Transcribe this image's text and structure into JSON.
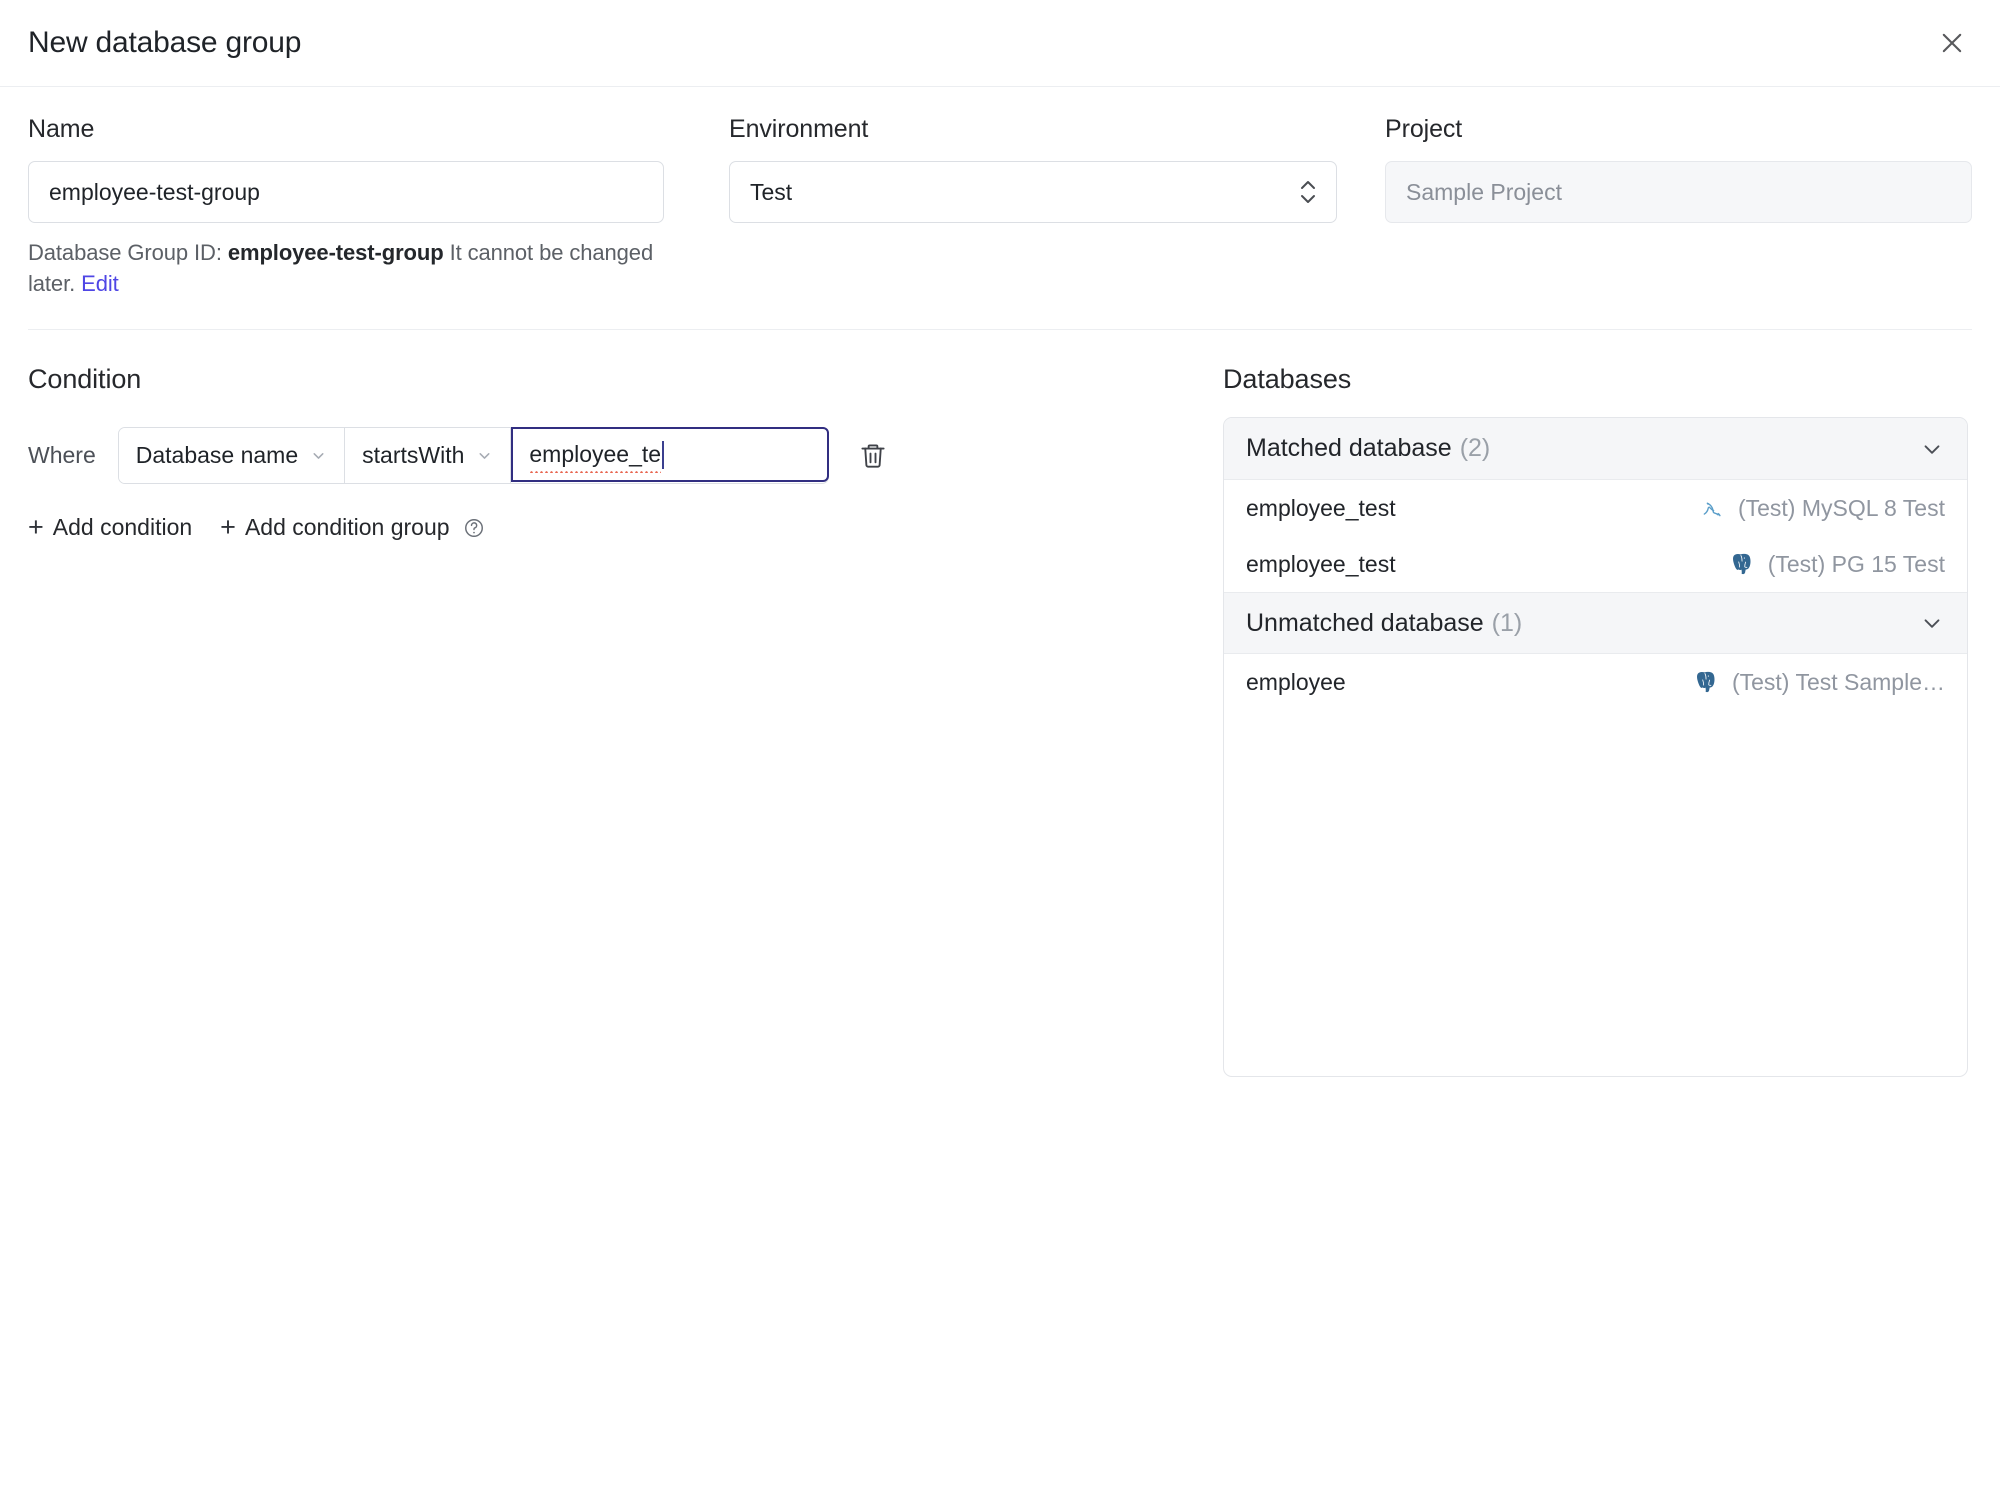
{
  "header": {
    "title": "New database group",
    "close_label": "Close",
    "close_icon": "close-icon"
  },
  "form": {
    "name": {
      "label": "Name",
      "value": "employee-test-group",
      "placeholder": "Name"
    },
    "environment": {
      "label": "Environment",
      "value": "Test",
      "options": [
        "Test"
      ],
      "icon": "chevron-up-down-icon"
    },
    "project": {
      "label": "Project",
      "value": "Sample Project",
      "disabled": true
    },
    "helper": {
      "prefix": "Database Group ID:",
      "id": "employee-test-group",
      "suffix": "It cannot be changed later.",
      "edit_label": "Edit",
      "edit_color": "#4f46e5"
    }
  },
  "condition": {
    "title": "Condition",
    "where_label": "Where",
    "field_select": {
      "value": "Database name",
      "icon": "chevron-down-icon"
    },
    "operator_select": {
      "value": "startsWith",
      "icon": "chevron-down-icon"
    },
    "value_input": {
      "value": "employee_te",
      "focused": true,
      "focus_color": "#312e81",
      "spellcheck_error": true
    },
    "delete_icon": "trash-icon",
    "add_condition": {
      "label": "Add condition",
      "icon": "plus-icon"
    },
    "add_condition_group": {
      "label": "Add condition group",
      "icon": "plus-icon",
      "help_icon": "question-circle-icon"
    }
  },
  "databases": {
    "title": "Databases",
    "groups": [
      {
        "title": "Matched database",
        "count": "(2)",
        "expanded": true,
        "chevron_icon": "chevron-down-icon",
        "items": [
          {
            "name": "employee_test",
            "instance": "(Test) MySQL 8 Test",
            "engine": "mysql-icon"
          },
          {
            "name": "employee_test",
            "instance": "(Test) PG 15 Test",
            "engine": "postgres-icon"
          }
        ]
      },
      {
        "title": "Unmatched database",
        "count": "(1)",
        "expanded": true,
        "chevron_icon": "chevron-down-icon",
        "items": [
          {
            "name": "employee",
            "instance": "(Test) Test Sample…",
            "engine": "postgres-icon"
          }
        ]
      }
    ]
  }
}
